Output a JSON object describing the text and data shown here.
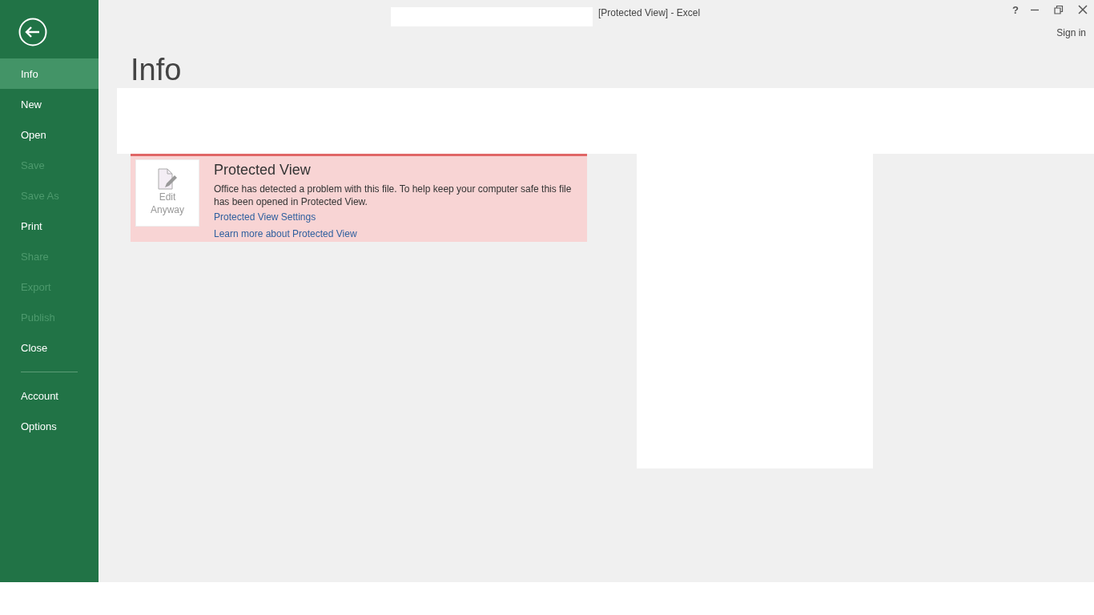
{
  "window": {
    "title": "[Protected View] - Excel",
    "help": "?",
    "sign_in": "Sign in"
  },
  "sidebar": {
    "items": [
      {
        "label": "Info",
        "selected": true,
        "disabled": false
      },
      {
        "label": "New",
        "selected": false,
        "disabled": false
      },
      {
        "label": "Open",
        "selected": false,
        "disabled": false
      },
      {
        "label": "Save",
        "selected": false,
        "disabled": true
      },
      {
        "label": "Save As",
        "selected": false,
        "disabled": true
      },
      {
        "label": "Print",
        "selected": false,
        "disabled": false
      },
      {
        "label": "Share",
        "selected": false,
        "disabled": true
      },
      {
        "label": "Export",
        "selected": false,
        "disabled": true
      },
      {
        "label": "Publish",
        "selected": false,
        "disabled": true
      },
      {
        "label": "Close",
        "selected": false,
        "disabled": false
      }
    ],
    "footer_items": [
      {
        "label": "Account",
        "selected": false,
        "disabled": false
      },
      {
        "label": "Options",
        "selected": false,
        "disabled": false
      }
    ]
  },
  "page_title": "Info",
  "protected_view": {
    "button": "Edit Anyway",
    "disabled": true,
    "title": "Protected View",
    "message": "Office has detected a problem with this file. To help keep your computer safe this file has been opened in Protected View.",
    "links": [
      "Protected View Settings",
      "Learn more about Protected View"
    ]
  }
}
